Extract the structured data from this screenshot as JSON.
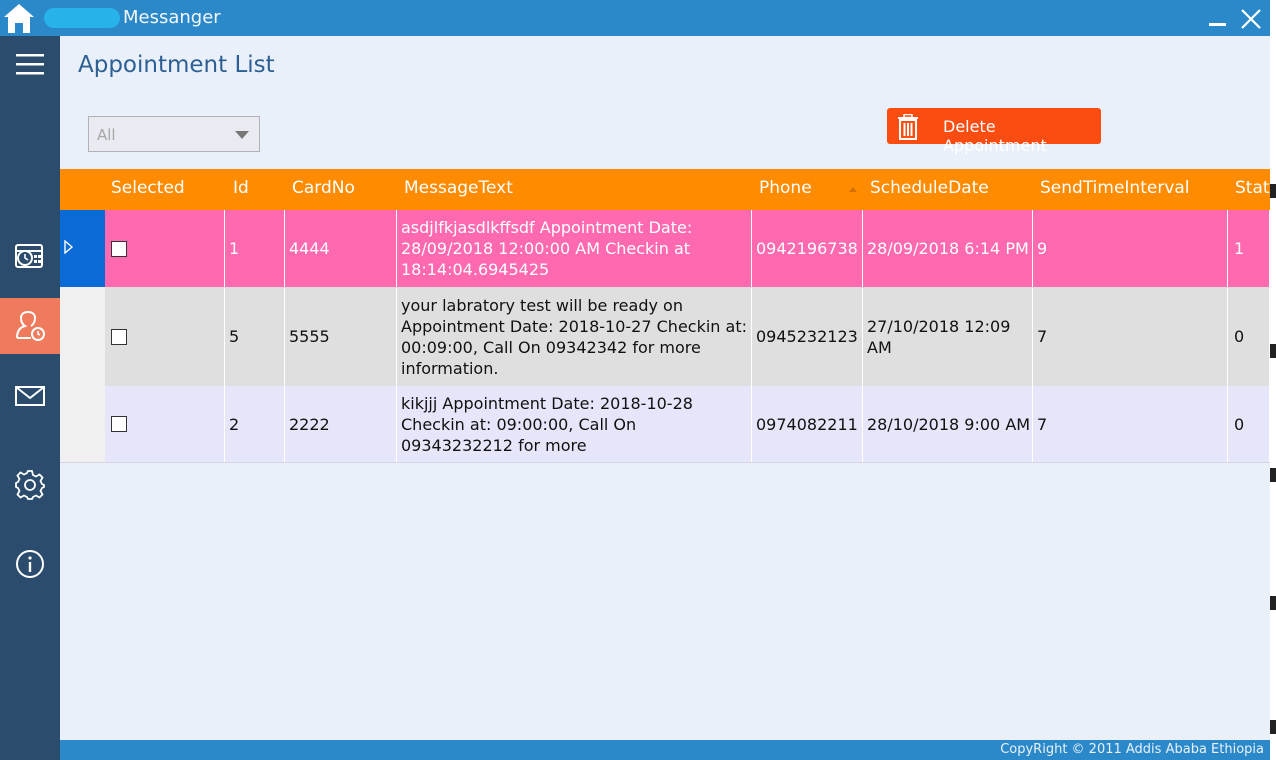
{
  "window": {
    "title": "Messanger",
    "minimize_icon": "minimize-icon",
    "close_icon": "close-icon",
    "titlebar_color": "#2c89c9"
  },
  "sidebar": {
    "items": [
      {
        "name": "menu",
        "icon": "hamburger-icon"
      },
      {
        "name": "schedule",
        "icon": "calendar-clock-icon"
      },
      {
        "name": "appointments",
        "icon": "user-clock-icon",
        "active": true
      },
      {
        "name": "messages",
        "icon": "envelope-icon"
      },
      {
        "name": "settings",
        "icon": "gear-icon"
      },
      {
        "name": "about",
        "icon": "info-icon"
      }
    ],
    "color": "#2b4c6c",
    "active_color": "#f07a5c"
  },
  "main": {
    "title": "Appointment List",
    "filter": {
      "value": "All"
    },
    "delete_button": {
      "label": "Delete Appointment",
      "icon": "trash-icon",
      "color": "#fb4c12"
    }
  },
  "grid": {
    "header_color": "#ff8b00",
    "columns": [
      "Selected",
      "Id",
      "CardNo",
      "MessageText",
      "Phone",
      "ScheduleDate",
      "SendTimeInterval",
      "Stat"
    ],
    "rows": [
      {
        "selected": false,
        "id": "1",
        "cardno": "4444",
        "message": "asdjlfkjasdlkffsdf Appointment Date: 28/09/2018 12:00:00 AM Checkin at 18:14:04.6945425",
        "phone": "0942196738",
        "schedule": "28/09/2018 6:14 PM",
        "interval": "9",
        "status": "1",
        "color": "#ff69b0"
      },
      {
        "selected": false,
        "id": "5",
        "cardno": "5555",
        "message": "your labratory test will be ready on Appointment Date: 2018-10-27 Checkin at: 00:09:00,  Call On 09342342 for more information.",
        "phone": "0945232123",
        "schedule": "27/10/2018 12:09 AM",
        "interval": "7",
        "status": "0",
        "color": "#dfdfdf"
      },
      {
        "selected": false,
        "id": "2",
        "cardno": "2222",
        "message": "kikjjj  Appointment Date: 2018-10-28 Checkin at: 09:00:00,  Call On 09343232212 for more",
        "phone": "0974082211",
        "schedule": "28/10/2018 9:00 AM",
        "interval": "7",
        "status": "0",
        "color": "#e6e6fa"
      }
    ]
  },
  "footer": {
    "copyright": "CopyRight © 2011 Addis Ababa Ethiopia"
  }
}
